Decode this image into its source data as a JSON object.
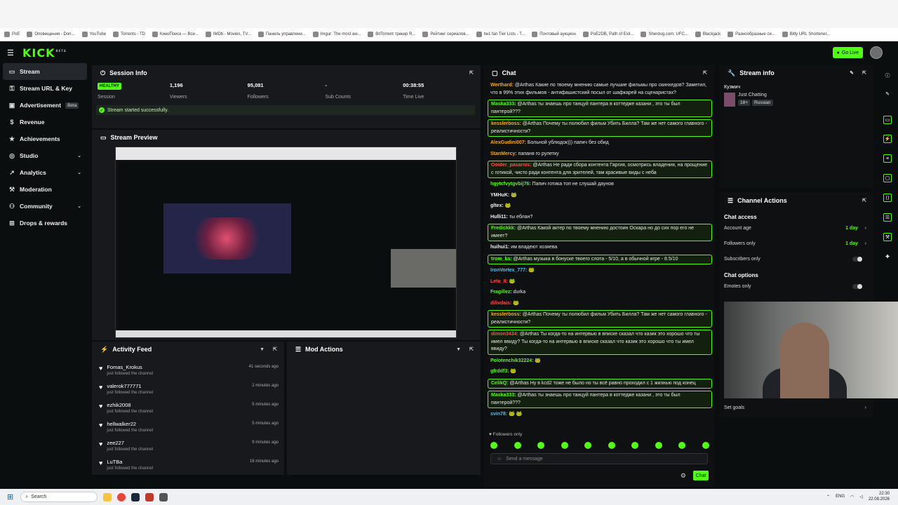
{
  "bookmarks": [
    "PoE",
    "Оповещения - Don...",
    "YouTube",
    "Torrents - TD",
    "КиноПоиск — Все...",
    "IMDb - Movies, TV...",
    "Панель управлени...",
    "Imgur: The most aw...",
    "BitTorrent трекер R...",
    "Рейтинг сериалов...",
    "№1 fan Tier Lists - T...",
    "Почтовый аукцион",
    "PoE2DB, Path of Exil...",
    "Sherdog.com: UFC...",
    "Blackjack",
    "Разнообразные си...",
    "Bitly URL Shortener..."
  ],
  "topnav": {
    "logo": "KICK",
    "logo_sup": "BETA",
    "go_live": "Go Live"
  },
  "sidebar": {
    "items": [
      {
        "label": "Stream",
        "icon": "stream-icon"
      },
      {
        "label": "Stream URL & Key",
        "icon": "key-icon"
      },
      {
        "label": "Advertisement",
        "badge": "Beta",
        "icon": "megaphone-icon"
      },
      {
        "label": "Revenue",
        "icon": "revenue-icon"
      },
      {
        "label": "Achievements",
        "icon": "trophy-icon"
      },
      {
        "label": "Studio",
        "icon": "studio-icon"
      },
      {
        "label": "Analytics",
        "icon": "analytics-icon"
      },
      {
        "label": "Moderation",
        "icon": "hammer-icon"
      },
      {
        "label": "Community",
        "icon": "community-icon"
      },
      {
        "label": "Drops & rewards",
        "icon": "gift-icon"
      }
    ]
  },
  "session": {
    "title": "Session Info",
    "health": "HEALTHY",
    "health_label": "Session",
    "viewers": "1,196",
    "viewers_label": "Viewers",
    "followers": "95,081",
    "followers_label": "Followers",
    "subs": "-",
    "subs_label": "Sub Counts",
    "time": "00:38:55",
    "time_label": "Time Live",
    "started": "Stream started successfully."
  },
  "preview": {
    "title": "Stream Preview"
  },
  "activity": {
    "title": "Activity Feed",
    "items": [
      {
        "name": "Fomas_Krokus",
        "sub": "just followed the channel",
        "time": "41 seconds ago"
      },
      {
        "name": "valerok777771",
        "sub": "just followed the channel",
        "time": "2 minutes ago"
      },
      {
        "name": "ezhik2008",
        "sub": "just followed the channel",
        "time": "5 minutes ago"
      },
      {
        "name": "hellwalker22",
        "sub": "just followed the channel",
        "time": "5 minutes ago"
      },
      {
        "name": "zee227",
        "sub": "just followed the channel",
        "time": "9 minutes ago"
      },
      {
        "name": "LuTBa",
        "sub": "just followed the channel",
        "time": "16 minutes ago"
      }
    ]
  },
  "mod": {
    "title": "Mod Actions"
  },
  "chat": {
    "title": "Chat",
    "followers_only": "Followers only",
    "placeholder": "Send a message",
    "send": "Chat",
    "messages": [
      {
        "user": "Werthard:",
        "text": " @Arthas Какие по твоему мнению самые лучшие фильмы про скинхедов? Заметил, что в 99% этих фильмов - антифашистский посыл от шафкарей на сценаристах?",
        "color": "#f6a623",
        "hl": false
      },
      {
        "user": "Maska333:",
        "text": " @Arthas ты знаешь про танцуй пантера в коттедже казани , это ты был пантерой???",
        "color": "#53fc18",
        "hl": true
      },
      {
        "user": "kesslerboss:",
        "text": " @Arthas Почему ты полюбил фильм Убить Билла? Там же нет самого главного - реалистичности?",
        "color": "#f6a623",
        "hl": true
      },
      {
        "user": "AlexGudini007:",
        "text": " Больной ублюдок))) папич без обид",
        "color": "#f6a623",
        "hl": false
      },
      {
        "user": "StanMercy:",
        "text": " папаня го рулетку",
        "color": "#f6a623",
        "hl": false
      },
      {
        "user": "Ooider_pasarnis:",
        "text": " @Arthas Не ради сбора контента Гаргия, осмотрись владения, на прощение с готикой, чисто ради контента для зрителей, там красивые виды с неба",
        "color": "#ff4d4d",
        "hl": true
      },
      {
        "user": "hgytcfvytgvbij76:",
        "text": " Папич готика топ не слушай даунов",
        "color": "#53fc18",
        "hl": false
      },
      {
        "user": "YMHuK:",
        "text": " 🐸",
        "color": "#f0f0f0",
        "hl": false
      },
      {
        "user": "gltex:",
        "text": " 🐸",
        "color": "#f0f0f0",
        "hl": false
      },
      {
        "user": "Hulli11:",
        "text": " ты еблан?",
        "color": "#f0f0f0",
        "hl": false
      },
      {
        "user": "Fredickkk:",
        "text": " @Arthas Какой актер по твоему мнению достоин Оскара но до сих пор его не имеет?",
        "color": "#53fc18",
        "hl": true
      },
      {
        "user": "huihui1:",
        "text": " им владеют хозяева",
        "color": "#f0f0f0",
        "hl": false
      },
      {
        "user": "trom_ka:",
        "text": " @Arthas музыка в бонуске твоего слота - 5/10, а в обычной игре - 8.5/10",
        "color": "#53fc18",
        "hl": true
      },
      {
        "user": "IronVortex_777:",
        "text": " 🐸",
        "color": "#4fc3f7",
        "hl": false
      },
      {
        "user": "Leto_II:",
        "text": " 🐸",
        "color": "#ff4d4d",
        "hl": false
      },
      {
        "user": "Fragillez:",
        "text": " durka",
        "color": "#53fc18",
        "hl": false
      },
      {
        "user": "dilivdais:",
        "text": " 🐸",
        "color": "#ff4d4d",
        "hl": false
      },
      {
        "user": "kesslerboss:",
        "text": " @Arthas Почему ты полюбил фильм Убить Билла? Там же нет самого главного - реалистичности?",
        "color": "#f6a623",
        "hl": true
      },
      {
        "user": "dimon3434:",
        "text": " @Arthas Ты когда-то на интервью в вписке сказал что казик это хорошо что ты имел ввиду? Ты когда-то на интервью в вписке сказал что казик это хорошо что ты имел ввиду?",
        "color": "#ff4d4d",
        "hl": true
      },
      {
        "user": "Polotenchik32224:",
        "text": " 🐸",
        "color": "#53fc18",
        "hl": false
      },
      {
        "user": "gfrddf3:",
        "text": " 🐸",
        "color": "#53fc18",
        "hl": false
      },
      {
        "user": "CelikQ:",
        "text": " @Arthas Ну в kcd2 тоже не было но ты всё равно проходил с 1 жизнью под конец",
        "color": "#53fc18",
        "hl": true
      },
      {
        "user": "Maska333:",
        "text": " @Arthas ты знаешь про танцуй пантера в коттедже казани , это ты был пантерой???",
        "color": "#53fc18",
        "hl": true
      },
      {
        "user": "svin78:",
        "text": " 🐸 🐸",
        "color": "#4fc3f7",
        "hl": false
      }
    ]
  },
  "stream_info": {
    "title": "Stream info",
    "user": "Кузмич",
    "category": "Just Chatting",
    "tag1": "18+",
    "tag2": "Russian"
  },
  "channel_actions": {
    "title": "Channel Actions",
    "chat_access": "Chat access",
    "account_age": "Account age",
    "account_age_val": "1 day",
    "followers_only": "Followers only",
    "followers_only_val": "1 day",
    "subscribers_only": "Subscribers only",
    "chat_options": "Chat options",
    "emotes_only": "Emotes only",
    "set_goals": "Set goals"
  },
  "taskbar": {
    "search": "Search",
    "lang": "ENG",
    "time": "22:30",
    "date": "22.08.2026"
  },
  "colors": {
    "accent": "#53fc18",
    "bg": "#0b0e0f",
    "panel": "#17191c"
  }
}
